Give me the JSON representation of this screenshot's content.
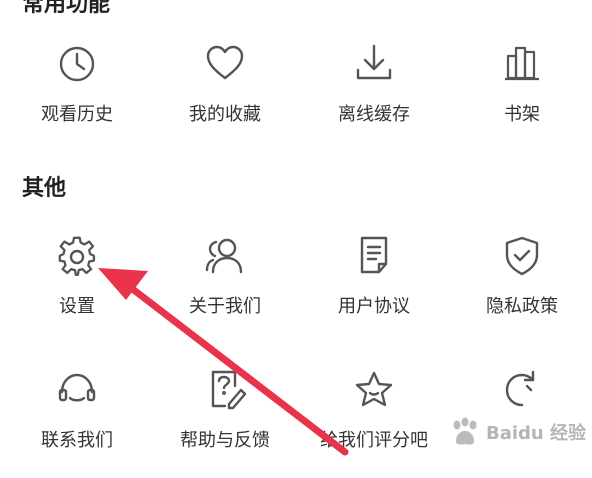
{
  "sections": {
    "top_heading": "常用功能",
    "other_title": "其他"
  },
  "row1": [
    {
      "label": "观看历史",
      "icon": "clock-icon"
    },
    {
      "label": "我的收藏",
      "icon": "heart-icon"
    },
    {
      "label": "离线缓存",
      "icon": "download-icon"
    },
    {
      "label": "书架",
      "icon": "bookshelf-icon"
    }
  ],
  "row2": [
    {
      "label": "设置",
      "icon": "gear-icon"
    },
    {
      "label": "关于我们",
      "icon": "users-icon"
    },
    {
      "label": "用户协议",
      "icon": "document-icon"
    },
    {
      "label": "隐私政策",
      "icon": "shield-check-icon"
    }
  ],
  "row3": [
    {
      "label": "联系我们",
      "icon": "headset-icon"
    },
    {
      "label": "帮助与反馈",
      "icon": "help-edit-icon"
    },
    {
      "label": "给我们评分吧",
      "icon": "star-icon"
    },
    {
      "label": "",
      "icon": "refresh-icon"
    }
  ],
  "watermark": {
    "text": "Baidu 经验"
  },
  "colors": {
    "arrow": "#e8334a",
    "icon_stroke": "#555555"
  }
}
